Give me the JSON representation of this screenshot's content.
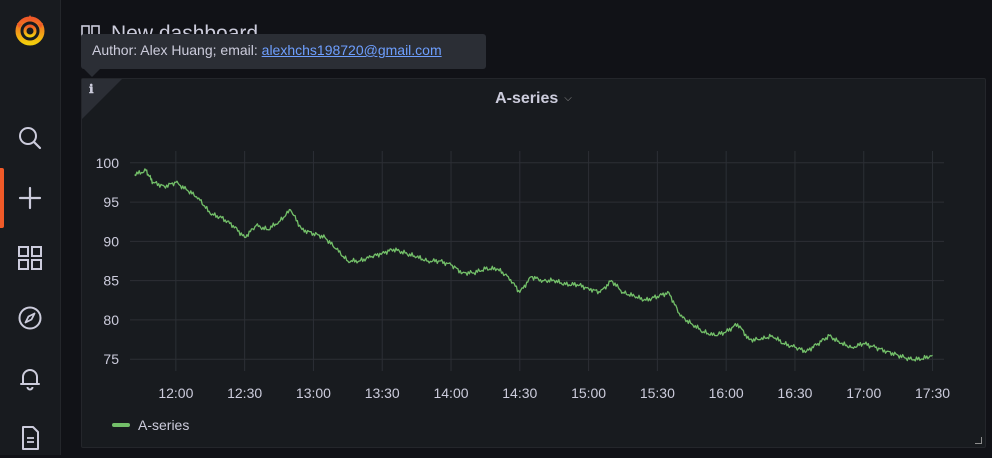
{
  "dashboard": {
    "title": "New dashboard"
  },
  "tooltip": {
    "prefix": "Author: Alex Huang; email: ",
    "email": "alexhchs198720@gmail.com"
  },
  "panel": {
    "title": "A-series",
    "info_icon": "ℹ"
  },
  "sidebar": {
    "items": [
      {
        "name": "grafana-logo",
        "icon": "grafana-logo"
      },
      {
        "name": "search",
        "icon": "search-icon"
      },
      {
        "name": "create",
        "icon": "plus-icon",
        "active": true
      },
      {
        "name": "dashboards",
        "icon": "apps-grid-icon"
      },
      {
        "name": "explore",
        "icon": "compass-icon"
      },
      {
        "name": "alerting",
        "icon": "bell-icon"
      },
      {
        "name": "docs",
        "icon": "file-icon"
      }
    ]
  },
  "colors": {
    "series": "#73bf69",
    "accent": "#f05a28",
    "link": "#6e9fff"
  },
  "chart_data": {
    "type": "line",
    "title": "A-series",
    "xlabel": "",
    "ylabel": "",
    "x_ticks": [
      "12:00",
      "12:30",
      "13:00",
      "13:30",
      "14:00",
      "14:30",
      "15:00",
      "15:30",
      "16:00",
      "16:30",
      "17:00",
      "17:30"
    ],
    "y_ticks": [
      100,
      95,
      90,
      85,
      80,
      75
    ],
    "ylim": [
      73.5,
      101.5
    ],
    "xlim": [
      "11:40",
      "17:35"
    ],
    "grid": true,
    "legend": "bottom-left",
    "series": [
      {
        "name": "A-series",
        "color": "#73bf69",
        "points": [
          [
            "11:42",
            98.5
          ],
          [
            "11:47",
            99.0
          ],
          [
            "11:50",
            97.5
          ],
          [
            "11:55",
            97.0
          ],
          [
            "12:00",
            97.5
          ],
          [
            "12:05",
            96.5
          ],
          [
            "12:10",
            95.5
          ],
          [
            "12:15",
            93.5
          ],
          [
            "12:20",
            93.0
          ],
          [
            "12:25",
            92.0
          ],
          [
            "12:30",
            90.5
          ],
          [
            "12:35",
            92.0
          ],
          [
            "12:40",
            91.5
          ],
          [
            "12:45",
            92.5
          ],
          [
            "12:50",
            94.0
          ],
          [
            "12:55",
            91.5
          ],
          [
            "13:00",
            91.0
          ],
          [
            "13:05",
            90.5
          ],
          [
            "13:10",
            89.0
          ],
          [
            "13:15",
            87.5
          ],
          [
            "13:20",
            87.5
          ],
          [
            "13:25",
            88.0
          ],
          [
            "13:30",
            88.5
          ],
          [
            "13:35",
            89.0
          ],
          [
            "13:40",
            88.5
          ],
          [
            "13:45",
            88.0
          ],
          [
            "13:50",
            87.5
          ],
          [
            "13:55",
            87.5
          ],
          [
            "14:00",
            87.0
          ],
          [
            "14:05",
            86.0
          ],
          [
            "14:10",
            86.0
          ],
          [
            "14:15",
            86.5
          ],
          [
            "14:20",
            86.5
          ],
          [
            "14:25",
            85.5
          ],
          [
            "14:30",
            83.5
          ],
          [
            "14:35",
            85.5
          ],
          [
            "14:40",
            85.0
          ],
          [
            "14:45",
            85.0
          ],
          [
            "14:50",
            84.5
          ],
          [
            "14:55",
            84.5
          ],
          [
            "15:00",
            84.0
          ],
          [
            "15:05",
            83.5
          ],
          [
            "15:10",
            85.0
          ],
          [
            "15:15",
            83.5
          ],
          [
            "15:20",
            83.0
          ],
          [
            "15:25",
            82.5
          ],
          [
            "15:30",
            83.0
          ],
          [
            "15:35",
            83.5
          ],
          [
            "15:40",
            80.5
          ],
          [
            "15:45",
            79.5
          ],
          [
            "15:50",
            78.5
          ],
          [
            "15:55",
            78.0
          ],
          [
            "16:00",
            78.5
          ],
          [
            "16:05",
            79.5
          ],
          [
            "16:10",
            77.5
          ],
          [
            "16:15",
            77.5
          ],
          [
            "16:20",
            78.0
          ],
          [
            "16:25",
            77.0
          ],
          [
            "16:30",
            76.5
          ],
          [
            "16:35",
            76.0
          ],
          [
            "16:40",
            77.0
          ],
          [
            "16:45",
            78.0
          ],
          [
            "16:50",
            77.0
          ],
          [
            "16:55",
            76.5
          ],
          [
            "17:00",
            77.0
          ],
          [
            "17:05",
            76.5
          ],
          [
            "17:10",
            76.0
          ],
          [
            "17:15",
            75.5
          ],
          [
            "17:20",
            75.0
          ],
          [
            "17:25",
            75.0
          ],
          [
            "17:30",
            75.5
          ]
        ]
      }
    ]
  }
}
